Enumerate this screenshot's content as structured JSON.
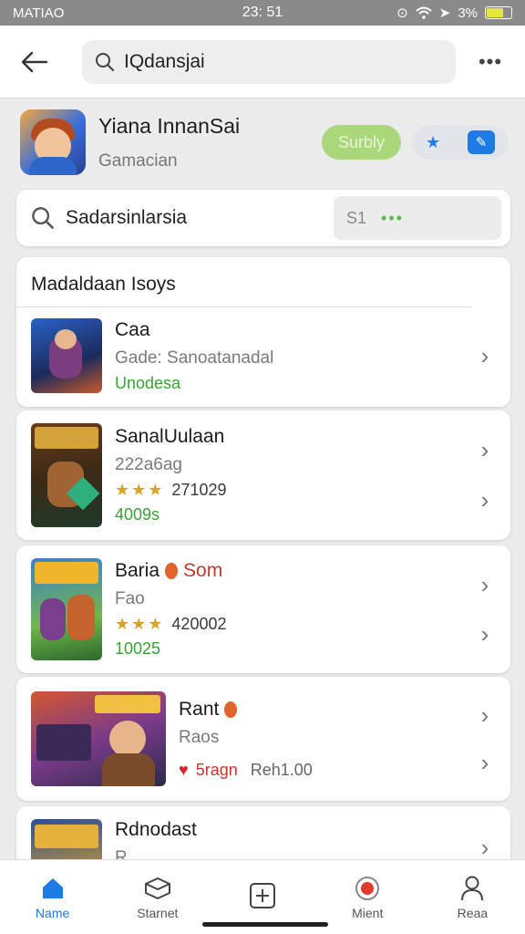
{
  "status_bar": {
    "carrier": "MATIAO",
    "time": "23: 51",
    "battery": "3%",
    "battery_level": 0.7
  },
  "app_bar": {
    "search_text": "IQdansjai"
  },
  "app_header": {
    "name": "Yiana InnanSai",
    "subtitle": "Gamacian",
    "green_button": "Surbly"
  },
  "search_card": {
    "text": "Sadarsinlarsia",
    "filter_value": "S1"
  },
  "section": {
    "title": "Madaldaan Isoys",
    "items": [
      {
        "title": "Caa",
        "line2": "Gade: Sanoatanadal",
        "line3": "Unodesa"
      },
      {
        "title": "SanalUulaan",
        "line2": "222a6ag",
        "rating": 2.5,
        "rating_text": "271029",
        "line4": "4009s"
      },
      {
        "title": "Baria",
        "badge": "Som",
        "line2": "Fao",
        "rating": 2.5,
        "rating_text": "420002",
        "line4": "10025"
      },
      {
        "title": "Rant",
        "line2": "Raos",
        "extra_left": "5ragn",
        "extra_right": "Reh1.00"
      },
      {
        "title": "Rdnodast",
        "line2": "R"
      }
    ]
  },
  "bottom_nav": [
    {
      "label": "Name",
      "icon": "home-icon",
      "active": true
    },
    {
      "label": "Starnet",
      "icon": "box-icon",
      "active": false
    },
    {
      "label": "",
      "icon": "add-square-icon",
      "active": false
    },
    {
      "label": "Mient",
      "icon": "record-icon",
      "active": false
    },
    {
      "label": "Reaa",
      "icon": "person-icon",
      "active": false
    }
  ],
  "colors": {
    "accent": "#1e7be6",
    "green": "#3aa234",
    "pill_green": "#a9d77a"
  }
}
